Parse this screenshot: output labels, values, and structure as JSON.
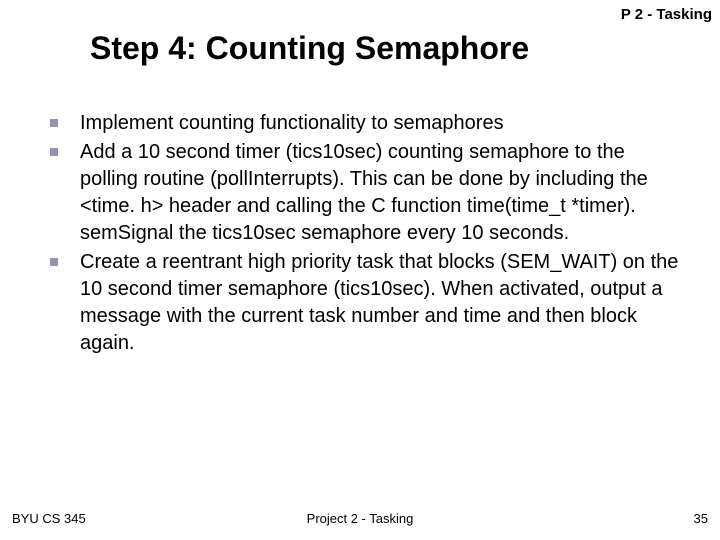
{
  "header": {
    "label": "P 2 - Tasking"
  },
  "title": "Step 4: Counting Semaphore",
  "bullets": [
    "Implement counting functionality to semaphores",
    "Add a 10 second timer (tics10sec) counting semaphore to the polling routine (pollInterrupts).  This can be done by including the <time. h> header and calling the C function time(time_t *timer).  semSignal the tics10sec semaphore every 10 seconds.",
    "Create a reentrant high priority task that blocks (SEM_WAIT) on the 10 second timer semaphore (tics10sec).  When activated, output a message with the current task number and time and then block again."
  ],
  "footer": {
    "left": "BYU CS 345",
    "center": "Project 2 - Tasking",
    "right": "35"
  }
}
